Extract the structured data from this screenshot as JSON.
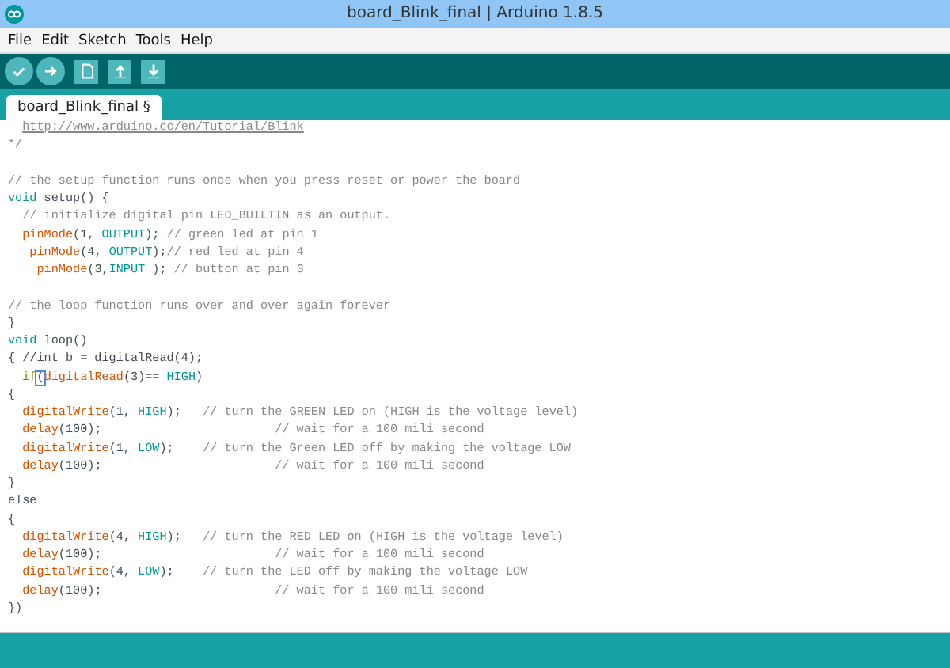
{
  "window": {
    "title": "board_Blink_final | Arduino 1.8.5"
  },
  "menu": [
    "File",
    "Edit",
    "Sketch",
    "Tools",
    "Help"
  ],
  "toolbar": [
    {
      "kind": "verify"
    },
    {
      "kind": "upload"
    },
    {
      "kind": "new"
    },
    {
      "kind": "open"
    },
    {
      "kind": "save"
    }
  ],
  "tabs": [
    {
      "label": "board_Blink_final §",
      "selected": true
    }
  ],
  "editor": {
    "lines": [
      {
        "kind": "code",
        "tokens": [
          {
            "kind": "link",
            "text": "  http://www.arduino.cc/en/Tutorial/Blink"
          }
        ]
      },
      {
        "kind": "code",
        "tokens": [
          {
            "kind": "comment",
            "text": "*/"
          }
        ]
      },
      {
        "kind": "blank"
      },
      {
        "kind": "code",
        "tokens": [
          {
            "kind": "comment",
            "text": "// the setup function runs once when you press reset or power the board"
          }
        ]
      },
      {
        "kind": "code",
        "tokens": [
          {
            "kind": "keyword",
            "text": "void"
          },
          {
            "kind": "plain",
            "text": " setup() {"
          }
        ]
      },
      {
        "kind": "code",
        "tokens": [
          {
            "kind": "comment",
            "text": "  // initialize digital pin LED_BUILTIN as an output."
          }
        ]
      },
      {
        "kind": "code",
        "tokens": [
          {
            "kind": "function",
            "text": "  pinMode"
          },
          {
            "kind": "plain",
            "text": "(1, "
          },
          {
            "kind": "keyword",
            "text": "OUTPUT"
          },
          {
            "kind": "plain",
            "text": "); "
          },
          {
            "kind": "comment",
            "text": "// green led at pin 1"
          }
        ]
      },
      {
        "kind": "code",
        "tokens": [
          {
            "kind": "function",
            "text": "   pinMode"
          },
          {
            "kind": "plain",
            "text": "(4, "
          },
          {
            "kind": "keyword",
            "text": "OUTPUT"
          },
          {
            "kind": "plain",
            "text": ");"
          },
          {
            "kind": "comment",
            "text": "// red led at pin 4"
          }
        ]
      },
      {
        "kind": "code",
        "tokens": [
          {
            "kind": "function",
            "text": "    pinMode"
          },
          {
            "kind": "plain",
            "text": "(3,"
          },
          {
            "kind": "keyword",
            "text": "INPUT"
          },
          {
            "kind": "plain",
            "text": " ); "
          },
          {
            "kind": "comment",
            "text": "// button at pin 3"
          }
        ]
      },
      {
        "kind": "blank"
      },
      {
        "kind": "code",
        "tokens": [
          {
            "kind": "comment",
            "text": "// the loop function runs over and over again forever"
          }
        ]
      },
      {
        "kind": "code",
        "tokens": [
          {
            "kind": "plain",
            "text": "}"
          }
        ]
      },
      {
        "kind": "code",
        "tokens": [
          {
            "kind": "keyword",
            "text": "void"
          },
          {
            "kind": "plain",
            "text": " loop()"
          }
        ]
      },
      {
        "kind": "code",
        "tokens": [
          {
            "kind": "plain",
            "text": "{ //int b = digitalRead(4);"
          }
        ]
      },
      {
        "kind": "code",
        "tokens": [
          {
            "kind": "control",
            "text": "  if"
          },
          {
            "kind": "match",
            "text": "("
          },
          {
            "kind": "function",
            "text": "digitalRead"
          },
          {
            "kind": "plain",
            "text": "(3)== "
          },
          {
            "kind": "keyword",
            "text": "HIGH"
          },
          {
            "kind": "plain",
            "text": ")"
          }
        ]
      },
      {
        "kind": "code",
        "tokens": [
          {
            "kind": "plain",
            "text": "{"
          }
        ]
      },
      {
        "kind": "code",
        "tokens": [
          {
            "kind": "function",
            "text": "  digitalWrite"
          },
          {
            "kind": "plain",
            "text": "(1, "
          },
          {
            "kind": "keyword",
            "text": "HIGH"
          },
          {
            "kind": "plain",
            "text": ");   "
          },
          {
            "kind": "comment",
            "text": "// turn the GREEN LED on (HIGH is the voltage level)"
          }
        ]
      },
      {
        "kind": "code",
        "tokens": [
          {
            "kind": "function",
            "text": "  delay"
          },
          {
            "kind": "plain",
            "text": "(100);                        "
          },
          {
            "kind": "comment",
            "text": "// wait for a 100 mili second"
          }
        ]
      },
      {
        "kind": "code",
        "tokens": [
          {
            "kind": "function",
            "text": "  digitalWrite"
          },
          {
            "kind": "plain",
            "text": "(1, "
          },
          {
            "kind": "keyword",
            "text": "LOW"
          },
          {
            "kind": "plain",
            "text": ");    "
          },
          {
            "kind": "comment",
            "text": "// turn the Green LED off by making the voltage LOW"
          }
        ]
      },
      {
        "kind": "code",
        "tokens": [
          {
            "kind": "function",
            "text": "  delay"
          },
          {
            "kind": "plain",
            "text": "(100);                        "
          },
          {
            "kind": "comment",
            "text": "// wait for a 100 mili second"
          }
        ]
      },
      {
        "kind": "code",
        "tokens": [
          {
            "kind": "plain",
            "text": "}"
          }
        ]
      },
      {
        "kind": "code",
        "tokens": [
          {
            "kind": "plain",
            "text": "else"
          }
        ]
      },
      {
        "kind": "code",
        "tokens": [
          {
            "kind": "plain",
            "text": "{"
          }
        ]
      },
      {
        "kind": "code",
        "tokens": [
          {
            "kind": "function",
            "text": "  digitalWrite"
          },
          {
            "kind": "plain",
            "text": "(4, "
          },
          {
            "kind": "keyword",
            "text": "HIGH"
          },
          {
            "kind": "plain",
            "text": ");   "
          },
          {
            "kind": "comment",
            "text": "// turn the RED LED on (HIGH is the voltage level)"
          }
        ]
      },
      {
        "kind": "code",
        "tokens": [
          {
            "kind": "function",
            "text": "  delay"
          },
          {
            "kind": "plain",
            "text": "(100);                        "
          },
          {
            "kind": "comment",
            "text": "// wait for a 100 mili second"
          }
        ]
      },
      {
        "kind": "code",
        "tokens": [
          {
            "kind": "function",
            "text": "  digitalWrite"
          },
          {
            "kind": "plain",
            "text": "(4, "
          },
          {
            "kind": "keyword",
            "text": "LOW"
          },
          {
            "kind": "plain",
            "text": ");    "
          },
          {
            "kind": "comment",
            "text": "// turn the LED off by making the voltage LOW"
          }
        ]
      },
      {
        "kind": "code",
        "tokens": [
          {
            "kind": "function",
            "text": "  delay"
          },
          {
            "kind": "plain",
            "text": "(100);                        "
          },
          {
            "kind": "comment",
            "text": "// wait for a 100 mili second"
          }
        ]
      },
      {
        "kind": "code",
        "tokens": [
          {
            "kind": "plain",
            "text": "})"
          }
        ]
      }
    ]
  }
}
